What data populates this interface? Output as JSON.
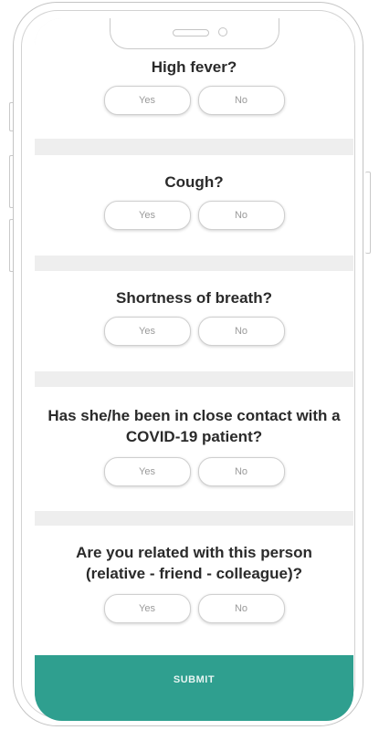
{
  "questions": [
    {
      "text": "High fever?",
      "yes": "Yes",
      "no": "No"
    },
    {
      "text": "Cough?",
      "yes": "Yes",
      "no": "No"
    },
    {
      "text": "Shortness of breath?",
      "yes": "Yes",
      "no": "No"
    },
    {
      "text": "Has she/he been in close contact with a COVID-19 patient?",
      "yes": "Yes",
      "no": "No"
    },
    {
      "text": "Are you related with this person (relative - friend - colleague)?",
      "yes": "Yes",
      "no": "No"
    }
  ],
  "submit_label": "SUBMIT",
  "colors": {
    "accent": "#2f9f8f",
    "divider": "#eeeeee"
  }
}
